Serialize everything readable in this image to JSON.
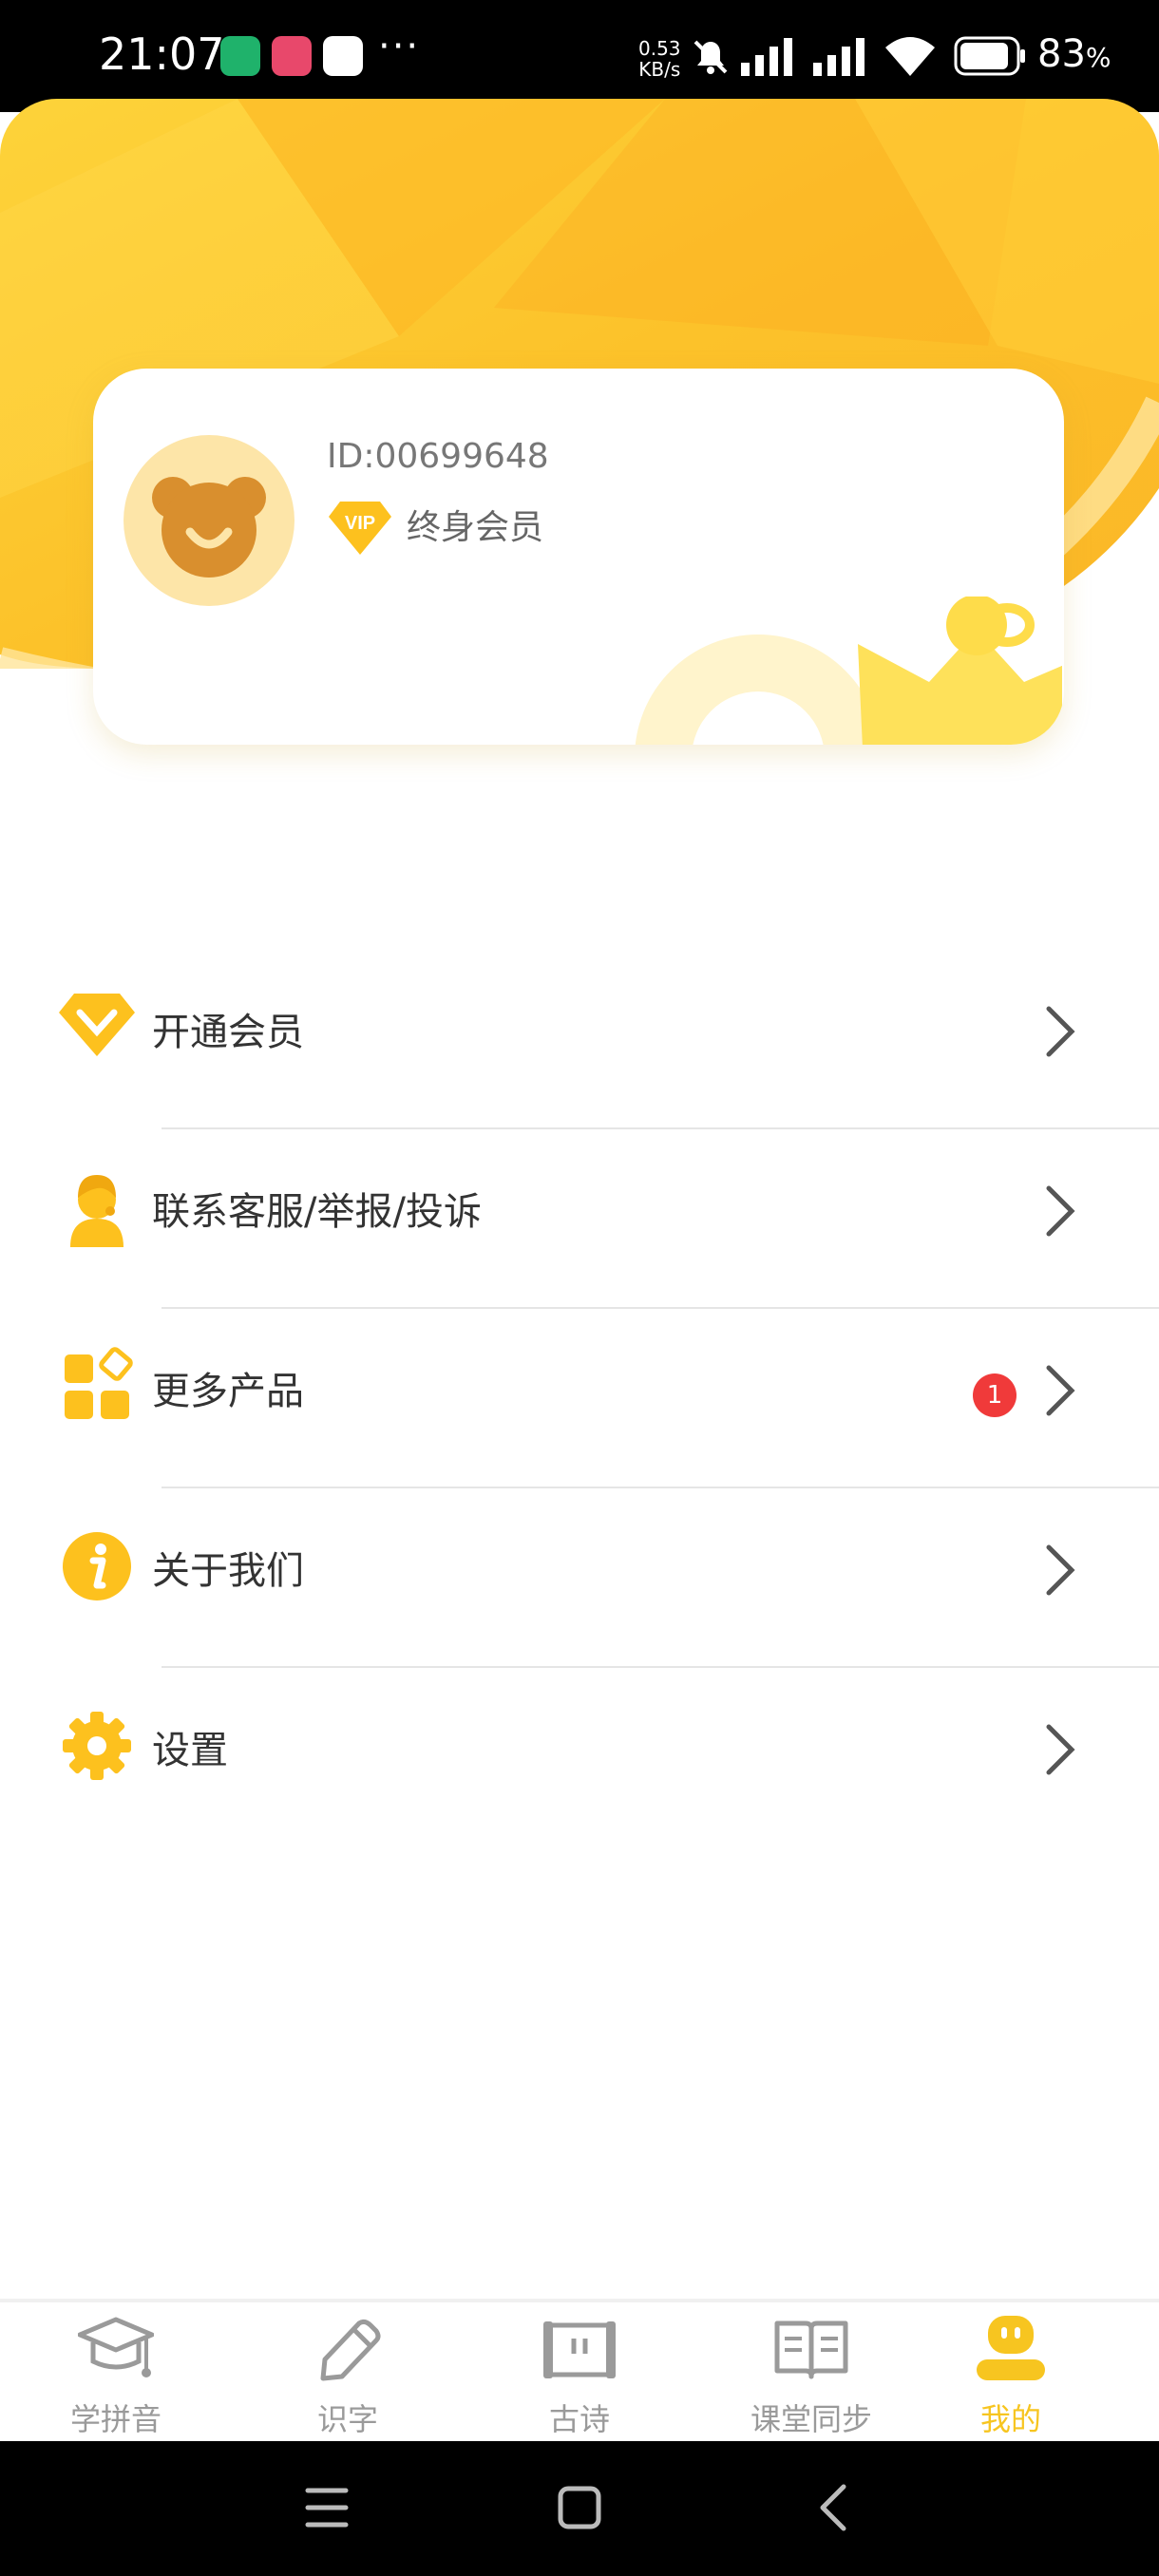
{
  "status_bar": {
    "time": "21:07",
    "more": "···",
    "net_speed_value": "0.53",
    "net_speed_unit": "KB/s",
    "battery": "83",
    "battery_unit": "%",
    "icons": [
      "mute-icon",
      "signal-icon",
      "signal-icon",
      "wifi-icon",
      "battery-icon"
    ]
  },
  "profile": {
    "id_text": "ID:00699648",
    "vip_badge": "VIP",
    "member_type": "终身会员",
    "avatar_icon": "bear-avatar-icon"
  },
  "menu": {
    "items": [
      {
        "label": "开通会员",
        "icon": "diamond-icon"
      },
      {
        "label": "联系客服/举报/投诉",
        "icon": "customer-service-icon"
      },
      {
        "label": "更多产品",
        "icon": "apps-icon",
        "badge": "1"
      },
      {
        "label": "关于我们",
        "icon": "info-icon"
      },
      {
        "label": "设置",
        "icon": "gear-icon"
      }
    ]
  },
  "bottom_nav": {
    "items": [
      {
        "label": "学拼音",
        "icon": "graduation-cap-icon",
        "active": false
      },
      {
        "label": "识字",
        "icon": "pencil-icon",
        "active": false
      },
      {
        "label": "古诗",
        "icon": "scroll-icon",
        "active": false
      },
      {
        "label": "课堂同步",
        "icon": "book-icon",
        "active": false
      },
      {
        "label": "我的",
        "icon": "profile-icon",
        "active": true
      }
    ]
  },
  "colors": {
    "accent": "#f7c520",
    "header_yellow": "#fcc62a",
    "badge_red": "#f03a3a",
    "inactive_text": "#9a9a9a"
  }
}
